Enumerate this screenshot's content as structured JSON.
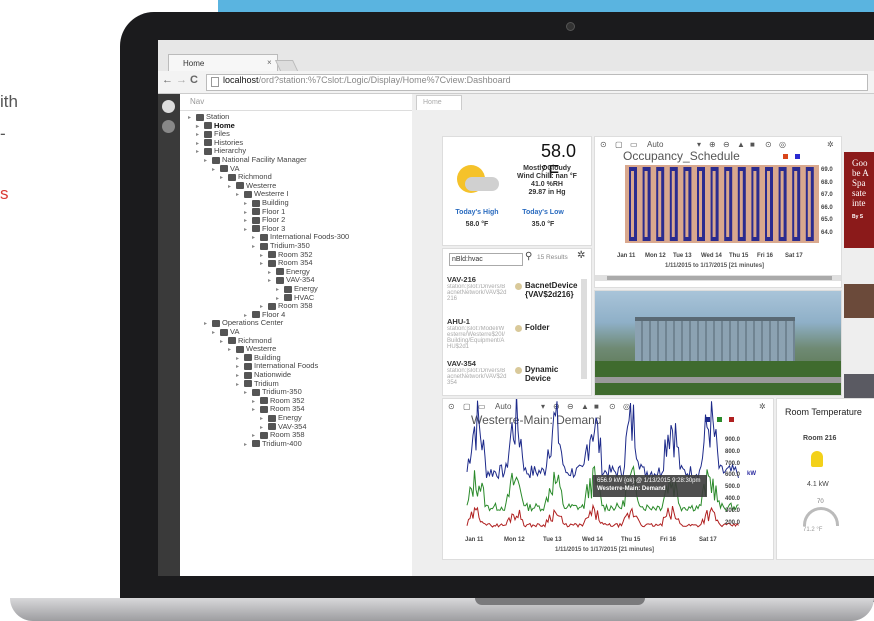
{
  "page": {
    "left_text_lines": [
      "ith",
      "-",
      "s"
    ],
    "colors": {
      "accent_blue": "#5ab4e0",
      "red_text": "#d93a34"
    }
  },
  "browser": {
    "tab_title": "Home",
    "tab_close": "×",
    "back": "←",
    "forward": "→",
    "reload": "C",
    "url_host": "localhost",
    "url_path": "/ord?station:%7Cslot:/Logic/Display/Home%7Cview:Dashboard"
  },
  "nav": {
    "header": "Nav",
    "tree": [
      {
        "label": "Station",
        "depth": 0,
        "bold": false
      },
      {
        "label": "Home",
        "depth": 1,
        "bold": true
      },
      {
        "label": "Files",
        "depth": 1,
        "bold": false
      },
      {
        "label": "Histories",
        "depth": 1,
        "bold": false
      },
      {
        "label": "Hierarchy",
        "depth": 1,
        "bold": false
      },
      {
        "label": "National Facility Manager",
        "depth": 2,
        "bold": false
      },
      {
        "label": "VA",
        "depth": 3,
        "bold": false
      },
      {
        "label": "Richmond",
        "depth": 4,
        "bold": false
      },
      {
        "label": "Westerre",
        "depth": 5,
        "bold": false
      },
      {
        "label": "Westerre I",
        "depth": 6,
        "bold": false
      },
      {
        "label": "Building",
        "depth": 7,
        "bold": false
      },
      {
        "label": "Floor 1",
        "depth": 7,
        "bold": false
      },
      {
        "label": "Floor 2",
        "depth": 7,
        "bold": false
      },
      {
        "label": "Floor 3",
        "depth": 7,
        "bold": false
      },
      {
        "label": "International Foods-300",
        "depth": 8,
        "bold": false
      },
      {
        "label": "Tridium-350",
        "depth": 8,
        "bold": false
      },
      {
        "label": "Room 352",
        "depth": 9,
        "bold": false
      },
      {
        "label": "Room 354",
        "depth": 9,
        "bold": false
      },
      {
        "label": "Energy",
        "depth": 10,
        "bold": false
      },
      {
        "label": "VAV-354",
        "depth": 10,
        "bold": false
      },
      {
        "label": "Energy",
        "depth": 11,
        "bold": false
      },
      {
        "label": "HVAC",
        "depth": 11,
        "bold": false
      },
      {
        "label": "Room 358",
        "depth": 9,
        "bold": false
      },
      {
        "label": "Floor 4",
        "depth": 7,
        "bold": false
      },
      {
        "label": "Operations Center",
        "depth": 2,
        "bold": false
      },
      {
        "label": "VA",
        "depth": 3,
        "bold": false
      },
      {
        "label": "Richmond",
        "depth": 4,
        "bold": false
      },
      {
        "label": "Westerre",
        "depth": 5,
        "bold": false
      },
      {
        "label": "Building",
        "depth": 6,
        "bold": false
      },
      {
        "label": "International Foods",
        "depth": 6,
        "bold": false
      },
      {
        "label": "Nationwide",
        "depth": 6,
        "bold": false
      },
      {
        "label": "Tridium",
        "depth": 6,
        "bold": false
      },
      {
        "label": "Tridium-350",
        "depth": 7,
        "bold": false
      },
      {
        "label": "Room 352",
        "depth": 8,
        "bold": false
      },
      {
        "label": "Room 354",
        "depth": 8,
        "bold": false
      },
      {
        "label": "Energy",
        "depth": 9,
        "bold": false
      },
      {
        "label": "VAV-354",
        "depth": 9,
        "bold": false
      },
      {
        "label": "Room 358",
        "depth": 8,
        "bold": false
      },
      {
        "label": "Tridium-400",
        "depth": 7,
        "bold": false
      }
    ]
  },
  "main": {
    "tab": "Home",
    "weather": {
      "temp": "58.0 °F",
      "condition": "Mostly Cloudy",
      "wind_chill": "Wind Chill: nan °F",
      "humidity": "41.0 %RH",
      "pressure": "29.87 in Hg",
      "high_label": "Today's High",
      "high_value": "58.0 °F",
      "low_label": "Today's Low",
      "low_value": "35.0 °F"
    },
    "occupancy": {
      "toolbar_mode": "Auto",
      "title": "Occupancy_Schedule",
      "y_ticks": [
        "69.0",
        "68.0",
        "67.0",
        "66.0",
        "65.0",
        "64.0"
      ],
      "x_ticks": [
        "Jan 11",
        "Mon 12",
        "Tue 13",
        "Wed 14",
        "Thu 15",
        "Fri 16",
        "Sat 17"
      ],
      "range": "1/11/2015 to 1/17/2015  [21 minutes]"
    },
    "search": {
      "value": "nBld:hvac",
      "results_count": "15 Results",
      "results": [
        {
          "name": "VAV-216",
          "path": "station:|slot:/Drivers/BacnetNetwork/VAV$2d216",
          "type": "BacnetDevice {VAV$2d216}"
        },
        {
          "name": "AHU-1",
          "path": "station:|slot:/Model/Westerre/Westerre$20I/Building/Equipment/AHU$2d1",
          "type": "Folder"
        },
        {
          "name": "VAV-354",
          "path": "station:|slot:/Drivers/BacnetNetwork/VAV$2d354",
          "type": "Dynamic Device"
        }
      ]
    },
    "demand": {
      "toolbar_mode": "Auto",
      "title": "Westerre-Main: Demand",
      "y_ticks": [
        "900.0",
        "800.0",
        "700.0",
        "600.0",
        "500.0",
        "400.0",
        "300.0",
        "200.0"
      ],
      "y_unit": "kW",
      "x_ticks": [
        "Jan 11",
        "Mon 12",
        "Tue 13",
        "Wed 14",
        "Thu 15",
        "Fri 16",
        "Sat 17"
      ],
      "range": "1/11/2015 to 1/17/2015  [21 minutes]",
      "tooltip_line1": "656.9 kW {ok} @ 1/13/2015 9:28:30pm",
      "tooltip_line2": "Westerre-Main: Demand",
      "series_colors": [
        "#1d2a8a",
        "#2a8a2a",
        "#b02020"
      ]
    },
    "room_temp": {
      "title": "Room Temperature",
      "room": "Room 216",
      "power": "4.1 kW",
      "gauge_top": "70",
      "gauge_value": "71.2 °F"
    },
    "news": {
      "headline": "Goo be A Spa sate inte",
      "byline": "By S"
    }
  }
}
